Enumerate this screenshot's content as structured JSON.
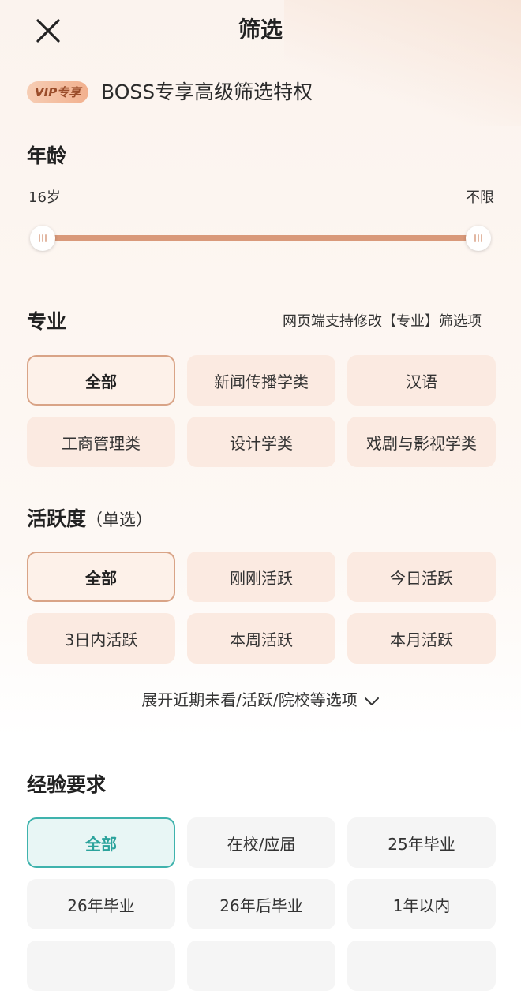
{
  "header": {
    "title": "筛选",
    "close_icon": "close-icon"
  },
  "vip": {
    "badge": "VIP专享",
    "title": "BOSS专享高级筛选特权"
  },
  "age": {
    "title": "年龄",
    "min_label": "16岁",
    "max_label": "不限",
    "range_fraction": [
      0,
      1
    ]
  },
  "major": {
    "title": "专业",
    "hint": "网页端支持修改【专业】筛选项",
    "options": [
      "全部",
      "新闻传播学类",
      "汉语",
      "工商管理类",
      "设计学类",
      "戏剧与影视学类"
    ],
    "selected_index": 0
  },
  "activity": {
    "title": "活跃度",
    "subtitle": "（单选）",
    "options": [
      "全部",
      "刚刚活跃",
      "今日活跃",
      "3日内活跃",
      "本周活跃",
      "本月活跃"
    ],
    "selected_index": 0
  },
  "expand": {
    "label": "展开近期未看/活跃/院校等选项",
    "icon": "chevron-down-icon"
  },
  "experience": {
    "title": "经验要求",
    "options": [
      "全部",
      "在校/应届",
      "25年毕业",
      "26年毕业",
      "26年后毕业",
      "1年以内"
    ],
    "selected_index": 0
  },
  "colors": {
    "accent_warm": "#d9997a",
    "selected_warm_border": "#d9a487",
    "selected_teal_border": "#3fb3ad",
    "selected_teal_text": "#2ba39c"
  }
}
